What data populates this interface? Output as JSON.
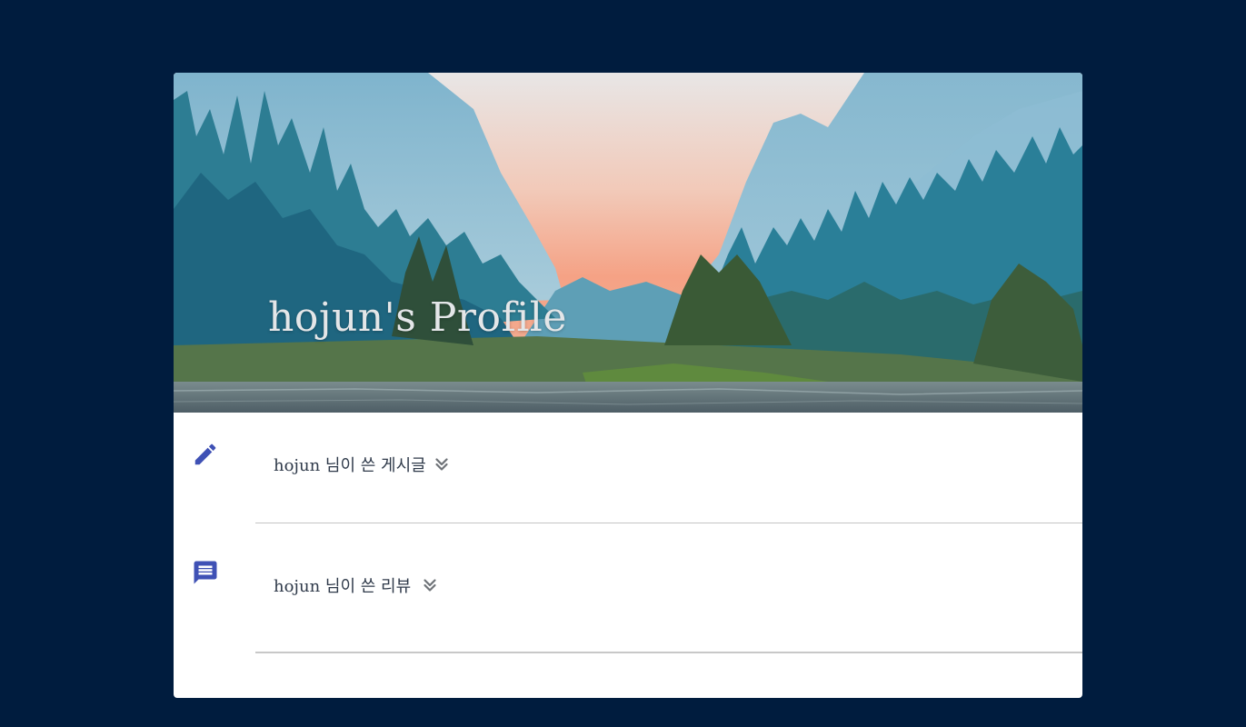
{
  "profile": {
    "title": "hojun's Profile"
  },
  "sections": [
    {
      "label": "hojun 님이 쓴 게시글",
      "icon": "edit-pencil-icon",
      "expand_icon": "double-chevron-down-icon"
    },
    {
      "label": "hojun 님이 쓴 리뷰",
      "icon": "comment-icon",
      "expand_icon": "double-chevron-down-icon"
    }
  ],
  "colors": {
    "page_background": "#001c3e",
    "card_background": "#ffffff",
    "icon_accent": "#3f51b5",
    "label_text": "#2f3a4a",
    "divider": "#c4c4c4"
  }
}
